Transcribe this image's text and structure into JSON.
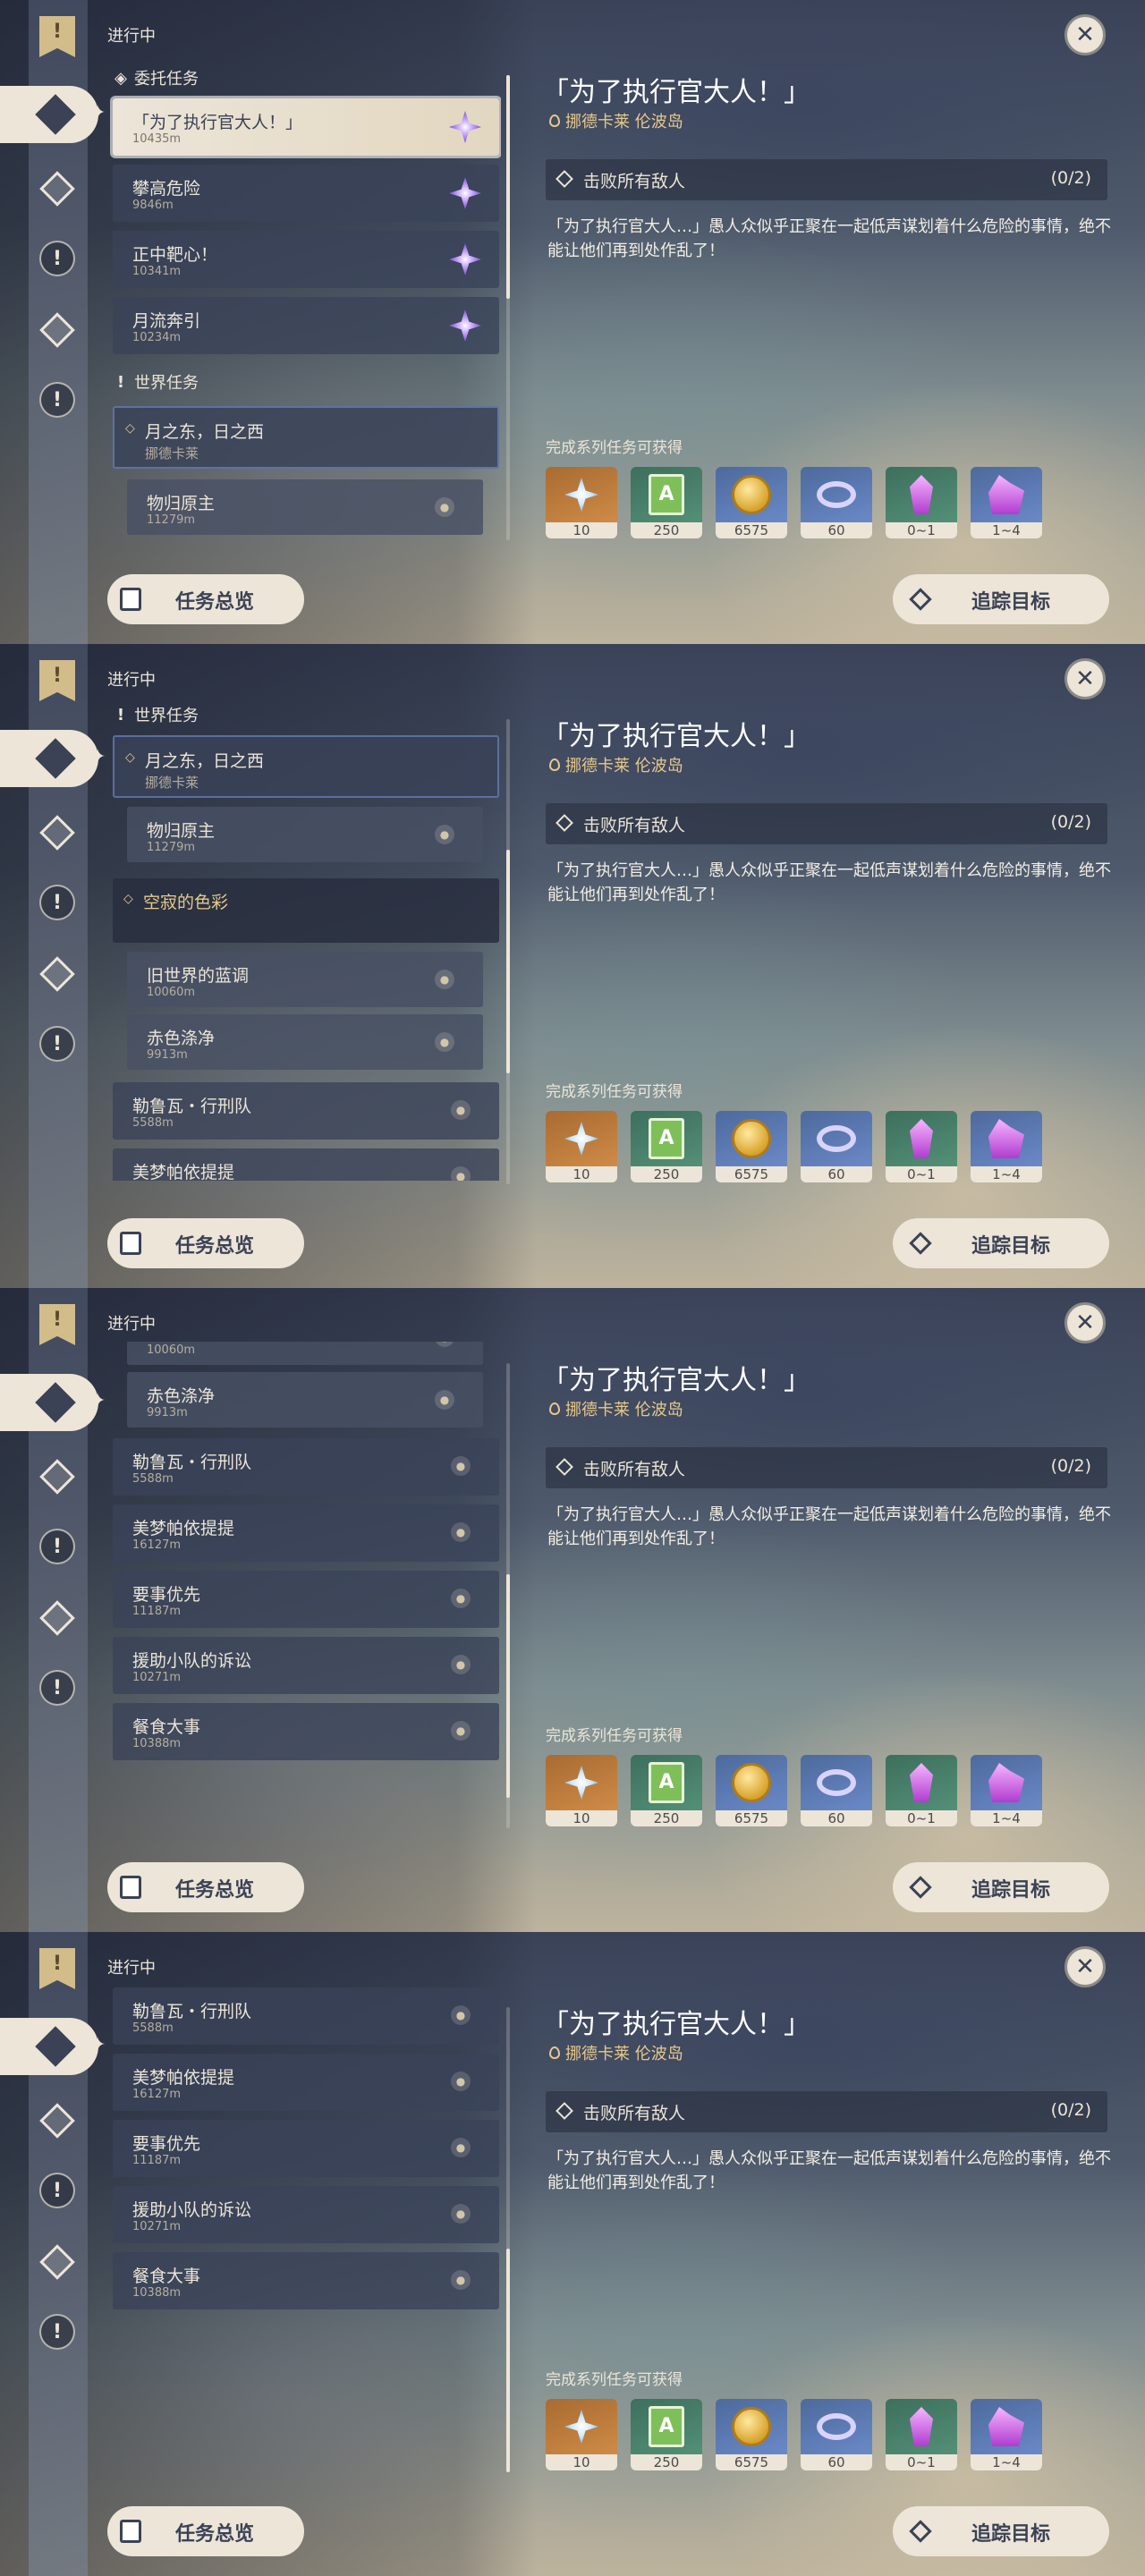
{
  "rail": {
    "flag_icon": "quest-flag-icon",
    "buttons": [
      "all-quests-icon",
      "archon-quest-icon",
      "story-quest-icon",
      "world-quest-icon",
      "commission-icon",
      "event-quest-icon"
    ]
  },
  "header": {
    "in_progress": "进行中",
    "close_icon": "✕"
  },
  "sections": {
    "commission": "委托任务",
    "world": "世界任务"
  },
  "detail": {
    "title": "「为了执行官大人！」",
    "location": "挪德卡莱 伦波岛",
    "objective": "击败所有敌人",
    "objective_count": "(0/2)",
    "description": "「为了执行官大人…」愚人众似乎正聚在一起低声谋划着什么危险的事情，绝不能让他们再到处作乱了！",
    "rewards_label": "完成系列任务可获得",
    "rewards": [
      {
        "icon": "primogem-icon",
        "count": "10"
      },
      {
        "icon": "adventure-exp-icon",
        "count": "250"
      },
      {
        "icon": "mora-icon",
        "count": "6575"
      },
      {
        "icon": "companionship-exp-icon",
        "count": "60"
      },
      {
        "icon": "crystal-chunk-icon",
        "count": "0~1"
      },
      {
        "icon": "crystal-cluster-icon",
        "count": "1~4"
      }
    ]
  },
  "footer": {
    "overview": "任务总览",
    "track": "追踪目标"
  },
  "quests": {
    "c1": {
      "title": "「为了执行官大人！」",
      "dist": "10435m"
    },
    "c2": {
      "title": "攀高危险",
      "dist": "9846m"
    },
    "c3": {
      "title": "正中靶心！",
      "dist": "10341m"
    },
    "c4": {
      "title": "月流奔引",
      "dist": "10234m"
    },
    "w1": {
      "title": "月之东，日之西",
      "sub": "挪德卡莱"
    },
    "w1a": {
      "title": "物归原主",
      "dist": "11279m"
    },
    "g2": {
      "title": "空寂的色彩"
    },
    "g2a": {
      "title": "旧世界的蓝调",
      "dist": "10060m"
    },
    "g2b": {
      "title": "赤色涤净",
      "dist": "9913m"
    },
    "q1": {
      "title": "勒鲁瓦・行刑队",
      "dist": "5588m"
    },
    "q2": {
      "title": "美梦帕依提提",
      "dist": "16127m"
    },
    "q3": {
      "title": "要事优先",
      "dist": "11187m"
    },
    "q4": {
      "title": "援助小队的诉讼",
      "dist": "10271m"
    },
    "q5": {
      "title": "餐食大事",
      "dist": "10388m"
    }
  }
}
